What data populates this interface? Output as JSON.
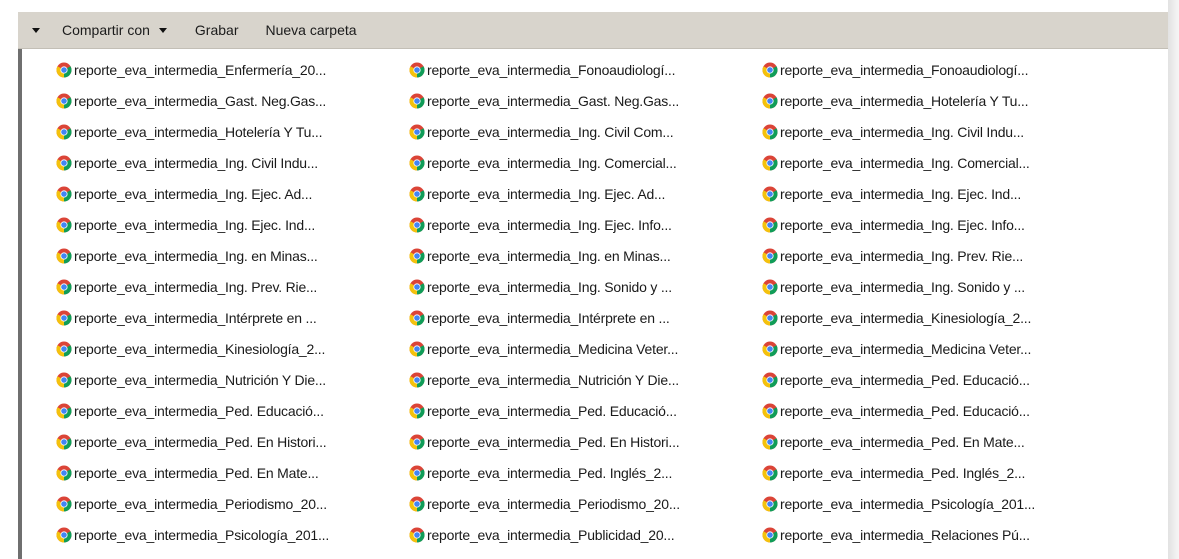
{
  "toolbar": {
    "share_label": "Compartir con",
    "record_label": "Grabar",
    "new_folder_label": "Nueva carpeta"
  },
  "file_icon": "chrome-icon",
  "files": [
    [
      "reporte_eva_intermedia_Enfermería_20...",
      "reporte_eva_intermedia_Fonoaudiologí...",
      "reporte_eva_intermedia_Fonoaudiologí..."
    ],
    [
      "reporte_eva_intermedia_Gast. Neg.Gas...",
      "reporte_eva_intermedia_Gast. Neg.Gas...",
      "reporte_eva_intermedia_Hotelería Y Tu..."
    ],
    [
      "reporte_eva_intermedia_Hotelería Y Tu...",
      "reporte_eva_intermedia_Ing. Civil Com...",
      "reporte_eva_intermedia_Ing. Civil Indu..."
    ],
    [
      "reporte_eva_intermedia_Ing. Civil Indu...",
      "reporte_eva_intermedia_Ing. Comercial...",
      "reporte_eva_intermedia_Ing. Comercial..."
    ],
    [
      "reporte_eva_intermedia_Ing. Ejec. Ad...",
      "reporte_eva_intermedia_Ing. Ejec. Ad...",
      "reporte_eva_intermedia_Ing. Ejec. Ind..."
    ],
    [
      "reporte_eva_intermedia_Ing. Ejec. Ind...",
      "reporte_eva_intermedia_Ing. Ejec. Info...",
      "reporte_eva_intermedia_Ing. Ejec. Info..."
    ],
    [
      "reporte_eva_intermedia_Ing. en Minas...",
      "reporte_eva_intermedia_Ing. en Minas...",
      "reporte_eva_intermedia_Ing. Prev. Rie..."
    ],
    [
      "reporte_eva_intermedia_Ing. Prev. Rie...",
      "reporte_eva_intermedia_Ing. Sonido y ...",
      "reporte_eva_intermedia_Ing. Sonido y ..."
    ],
    [
      "reporte_eva_intermedia_Intérprete en ...",
      "reporte_eva_intermedia_Intérprete en ...",
      "reporte_eva_intermedia_Kinesiología_2..."
    ],
    [
      "reporte_eva_intermedia_Kinesiología_2...",
      "reporte_eva_intermedia_Medicina Veter...",
      "reporte_eva_intermedia_Medicina Veter..."
    ],
    [
      "reporte_eva_intermedia_Nutrición Y Die...",
      "reporte_eva_intermedia_Nutrición Y Die...",
      "reporte_eva_intermedia_Ped. Educació..."
    ],
    [
      "reporte_eva_intermedia_Ped. Educació...",
      "reporte_eva_intermedia_Ped. Educació...",
      "reporte_eva_intermedia_Ped. Educació..."
    ],
    [
      "reporte_eva_intermedia_Ped. En Histori...",
      "reporte_eva_intermedia_Ped. En Histori...",
      "reporte_eva_intermedia_Ped. En Mate..."
    ],
    [
      "reporte_eva_intermedia_Ped. En Mate...",
      "reporte_eva_intermedia_Ped. Inglés_2...",
      "reporte_eva_intermedia_Ped. Inglés_2..."
    ],
    [
      "reporte_eva_intermedia_Periodismo_20...",
      "reporte_eva_intermedia_Periodismo_20...",
      "reporte_eva_intermedia_Psicología_201..."
    ],
    [
      "reporte_eva_intermedia_Psicología_201...",
      "reporte_eva_intermedia_Publicidad_20...",
      "reporte_eva_intermedia_Relaciones Pú..."
    ]
  ],
  "colors": {
    "toolbar_bg": "#d8d4cc",
    "chrome_red": "#db4437",
    "chrome_yellow": "#f4c20d",
    "chrome_green": "#0f9d58",
    "chrome_blue": "#4285f4"
  }
}
